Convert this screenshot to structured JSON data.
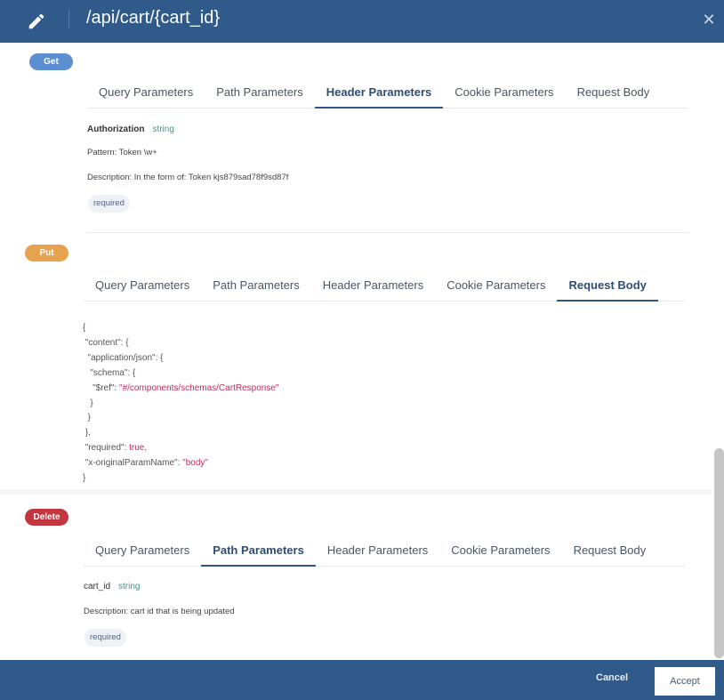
{
  "header": {
    "title": "/api/cart/{cart_id}",
    "edit_icon": "pencil-icon",
    "close_icon": "close-icon",
    "close_glyph": "✕",
    "color": "#2f5a8a"
  },
  "sections": [
    {
      "method": "Get",
      "color": "#5b8fd1",
      "tabs": [
        "Query Parameters",
        "Path Parameters",
        "Header Parameters",
        "Cookie Parameters",
        "Request Body"
      ],
      "active_tab": "Header Parameters",
      "param": {
        "name": "Authorization",
        "type": "string",
        "pattern": "Pattern: Token \\w+",
        "description": "Description: In the form of: Token kjs879sad78f9sd87f",
        "required": "required"
      }
    },
    {
      "method": "Put",
      "color": "#e6a24e",
      "tabs": [
        "Query Parameters",
        "Path Parameters",
        "Header Parameters",
        "Cookie Parameters",
        "Request Body"
      ],
      "active_tab": "Request Body",
      "json_lines": [
        {
          "indent": "",
          "key": "{",
          "value": ""
        },
        {
          "indent": " ",
          "key": "\"content\": {",
          "value": ""
        },
        {
          "indent": "  ",
          "key": "\"application/json\": {",
          "value": ""
        },
        {
          "indent": "   ",
          "key": "\"schema\": {",
          "value": ""
        },
        {
          "indent": "    ",
          "key": "\"$ref\": ",
          "value": "\"#/components/schemas/CartResponse\""
        },
        {
          "indent": "   ",
          "key": "}",
          "value": ""
        },
        {
          "indent": "  ",
          "key": "}",
          "value": ""
        },
        {
          "indent": " ",
          "key": "},",
          "value": ""
        },
        {
          "indent": " ",
          "key": "\"required\": ",
          "value": "true,"
        },
        {
          "indent": " ",
          "key": "\"x-originalParamName\": ",
          "value": "\"body\""
        },
        {
          "indent": "",
          "key": "}",
          "value": ""
        }
      ]
    },
    {
      "method": "Delete",
      "color": "#c2373f",
      "tabs": [
        "Query Parameters",
        "Path Parameters",
        "Header Parameters",
        "Cookie Parameters",
        "Request Body"
      ],
      "active_tab": "Path Parameters",
      "param": {
        "name": "cart_id",
        "type": "string",
        "description": "Description: cart id that is being updated",
        "required": "required"
      }
    }
  ],
  "footer": {
    "cancel_label": "Cancel",
    "accept_label": "Accept"
  }
}
